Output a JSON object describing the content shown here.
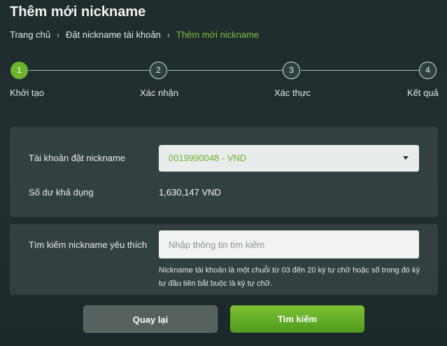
{
  "page": {
    "title": "Thêm mới nickname"
  },
  "breadcrumb": {
    "items": [
      "Trang chủ",
      "Đặt nickname tài khoản"
    ],
    "current": "Thêm mới nickname",
    "separator": "›"
  },
  "stepper": {
    "steps": [
      {
        "number": "1",
        "label": "Khởi tạo",
        "active": true
      },
      {
        "number": "2",
        "label": "Xác nhận",
        "active": false
      },
      {
        "number": "3",
        "label": "Xác thực",
        "active": false
      },
      {
        "number": "4",
        "label": "Kết quả",
        "active": false
      }
    ]
  },
  "account": {
    "label": "Tài khoản đặt nickname",
    "selected": "0019990048 - VND",
    "balance_label": "Số dư khả dụng",
    "balance_value": "1,630,147 VND"
  },
  "search": {
    "label": "Tìm kiếm nickname yêu thích",
    "placeholder": "Nhập thông tin tìm kiếm",
    "value": "",
    "hint": "Nickname tài khoản là một chuỗi từ 03 đến 20 ký tự chữ hoặc số trong đó ký tự đầu tiên bắt buộc là ký tự chữ."
  },
  "actions": {
    "back_label": "Quay lại",
    "search_label": "Tìm kiếm"
  },
  "colors": {
    "accent": "#6cb42b",
    "background": "#223032",
    "panel": "#344243"
  }
}
